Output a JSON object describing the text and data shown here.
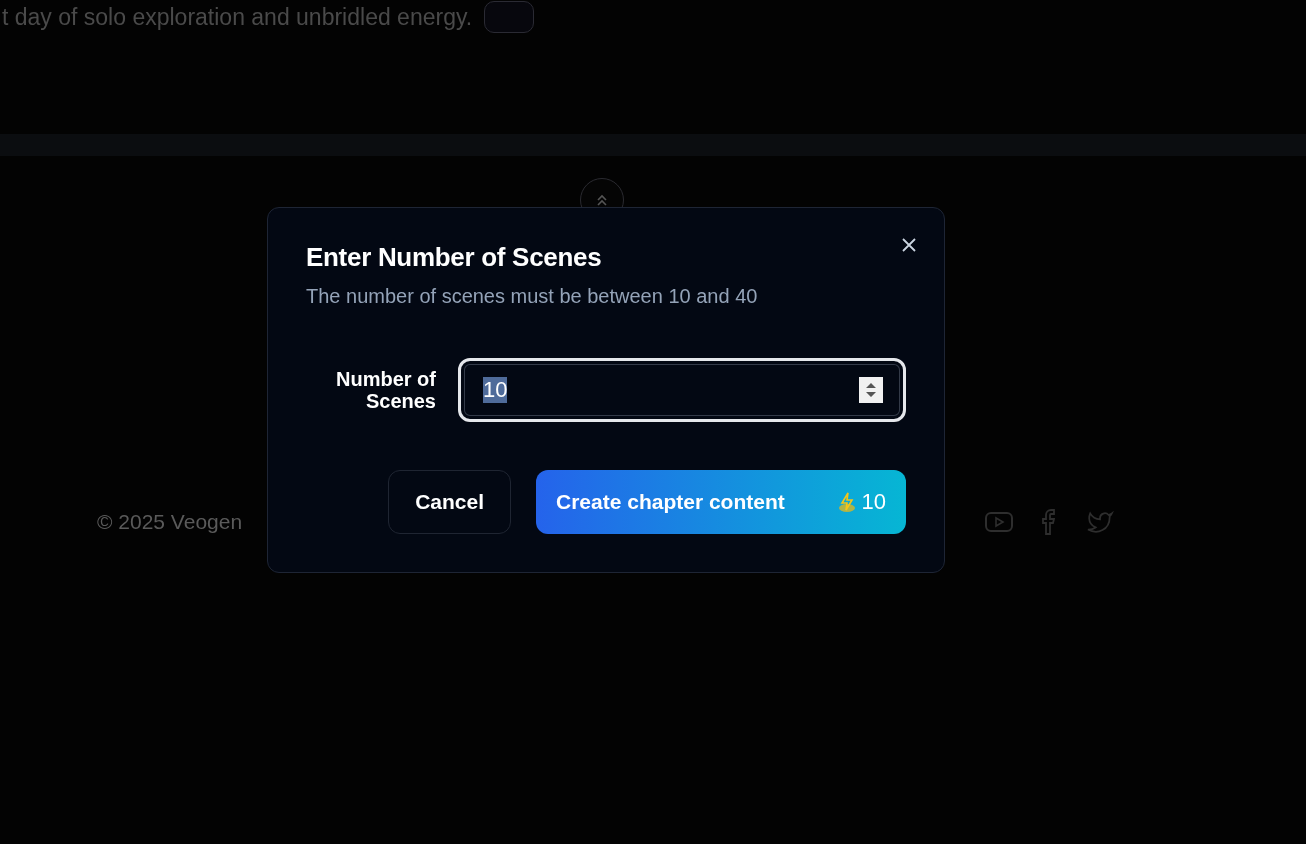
{
  "page": {
    "intro_text": "t day of solo exploration and unbridled energy.",
    "footer_text": "© 2025 Veogen"
  },
  "dialog": {
    "title": "Enter Number of Scenes",
    "description": "The number of scenes must be between 10 and 40",
    "field_label": "Number of Scenes",
    "field_value": "10",
    "cancel_label": "Cancel",
    "submit_label": "Create chapter content",
    "credit_cost": "10"
  }
}
